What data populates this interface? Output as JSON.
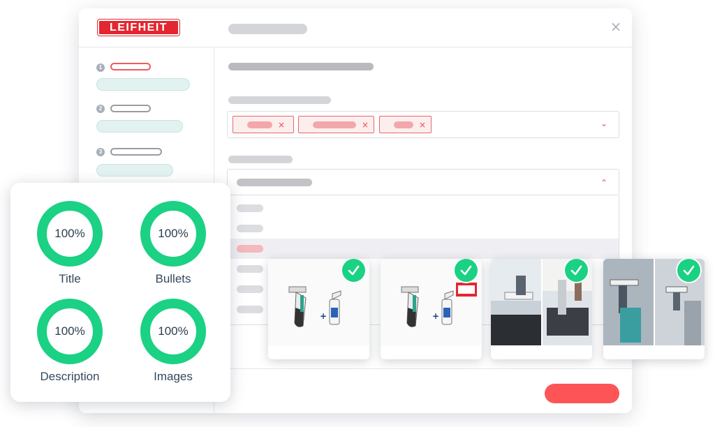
{
  "brand": {
    "logo_text": "LEIFHEIT",
    "logo_color": "#e3262f"
  },
  "header": {
    "close_icon": "close-icon",
    "close_glyph": "×"
  },
  "steps": [
    {
      "number": "1",
      "state": "active"
    },
    {
      "number": "2",
      "state": "default"
    },
    {
      "number": "3",
      "state": "default"
    }
  ],
  "select_chevron_down": "⌄",
  "select_chevron_up": "⌃",
  "tag_remove_glyph": "×",
  "scores": {
    "ring_color": "#1bd184",
    "items": [
      {
        "value": "100%",
        "label": "Title"
      },
      {
        "value": "100%",
        "label": "Bullets"
      },
      {
        "value": "100%",
        "label": "Description"
      },
      {
        "value": "100%",
        "label": "Images"
      }
    ]
  },
  "images": [
    {
      "alt": "window-vacuum-with-spray-bottle",
      "checked": true
    },
    {
      "alt": "window-vacuum-with-spray-bottle-and-badge",
      "checked": true
    },
    {
      "alt": "window-vacuum-in-kitchen-use",
      "checked": true
    },
    {
      "alt": "window-vacuum-in-bathroom-use",
      "checked": true
    }
  ],
  "colors": {
    "accent": "#fd5557",
    "success": "#1bd184",
    "tag_border": "#e36a6e"
  }
}
